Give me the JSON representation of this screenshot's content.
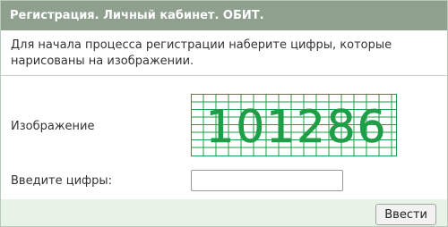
{
  "header": {
    "title": "Регистрация. Личный кабинет. ОБИТ."
  },
  "intro": {
    "text": "Для начала процесса регистрации наберите цифры, которые нарисованы на изображении."
  },
  "form": {
    "image_label": "Изображение",
    "digits_label": "Введите цифры:",
    "digits_value": "",
    "captcha_code": "101286",
    "captcha_color": "#1e9e46",
    "submit_label": "Ввести"
  },
  "colors": {
    "header_bg": "#8fa08f",
    "footer_bg": "#e8f3e8",
    "captcha_line": "#1e9e46"
  }
}
